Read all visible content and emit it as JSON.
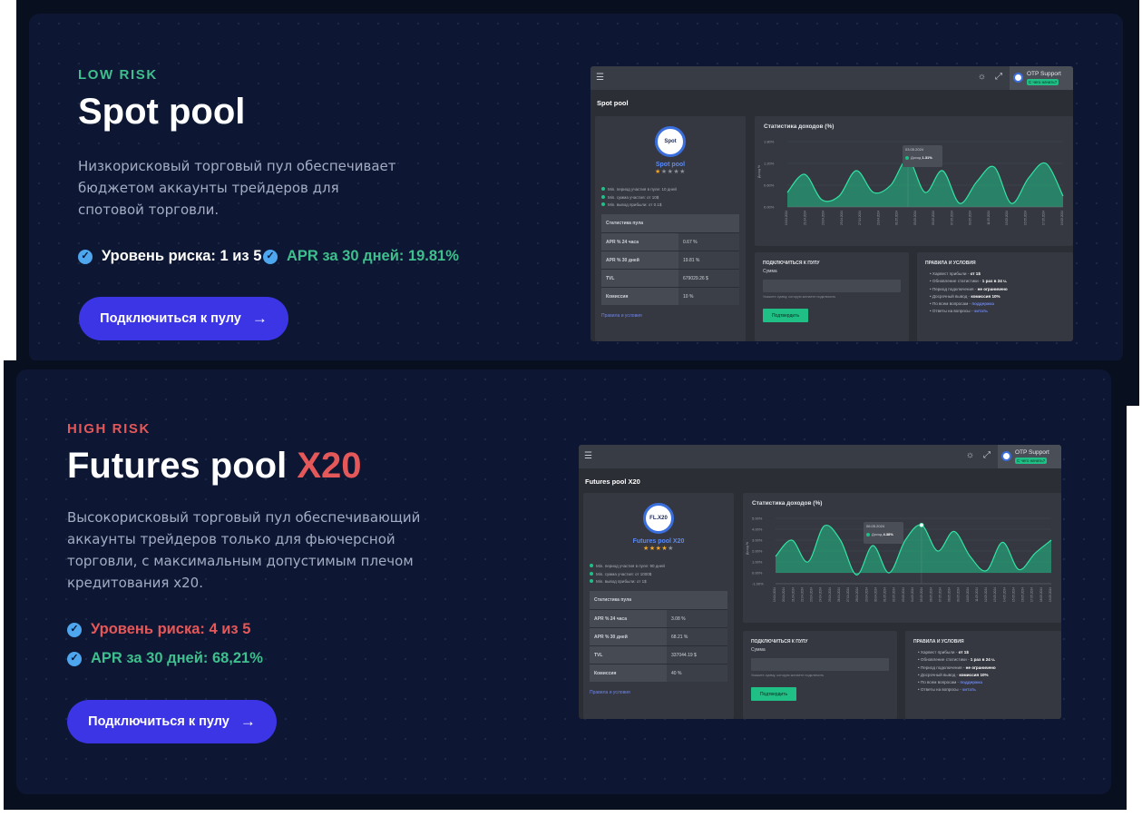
{
  "spot": {
    "risk_tag": "LOW RISK",
    "title": "Spot pool",
    "description": "Низкорисковый торговый пул обеспечивает бюджетом аккаунты трейдеров для спотовой торговли.",
    "feature_risk": "Уровень риска: 1 из 5",
    "feature_apr": "APR за 30 дней: 19.81%",
    "cta": "Подключиться к пулу",
    "preview": {
      "menu_icon": "hamburger-icon",
      "theme_icon": "sun-icon",
      "fullscreen_icon": "expand-icon",
      "user_name": "OTP Support",
      "user_badge": "С чего начать?",
      "page_title": "Spot pool",
      "logo_text": "Spot",
      "pool_name": "Spot pool",
      "rating": 1,
      "rating_max": 5,
      "bullets": [
        "Min. период участия в пуле: 10 дней",
        "Min. сумма участия: от 10$",
        "Min. вывод прибыли: от 0.1$"
      ],
      "stats_title": "Статистика пула",
      "stats": [
        {
          "label": "APR % 24 часа",
          "value": "0.67 %"
        },
        {
          "label": "APR % 30 дней",
          "value": "19.81 %"
        },
        {
          "label": "TVL",
          "value": "679029.26 $"
        },
        {
          "label": "Комиссия",
          "value": "10 %"
        }
      ],
      "rules_link": "Правила и условия",
      "chart_title": "Статистика доходов (%)",
      "tooltip_date": "03.05.2024",
      "tooltip_label": "Доход",
      "tooltip_value": "1.31%",
      "connect_title": "Подключиться к пулу",
      "amount_label": "Сумма",
      "amount_hint": "Укажите сумму, которую желаете подключить",
      "confirm_button": "Подтвердить",
      "rules_title": "Правила и условия",
      "rules": [
        {
          "text": "Харвест прибыли - ",
          "value": "от 1$"
        },
        {
          "text": "Обновление статистики - ",
          "value": "1 раз в 24 ч."
        },
        {
          "text": "Период подключения - ",
          "value": "не ограничено"
        },
        {
          "text": "Досрочный вывод - ",
          "value": "комиссия 10%"
        },
        {
          "text": "По всем вопросам - ",
          "value": "поддержка",
          "link": true
        },
        {
          "text": "Ответы на вопросы - ",
          "value": "читать",
          "link": true
        }
      ]
    }
  },
  "futures": {
    "risk_tag": "HIGH RISK",
    "title": "Futures pool ",
    "title_accent": "X20",
    "description": "Высокорисковый торговый пул обеспечивающий аккаунты трейдеров только для фьючерсной торговли, с максимальным допустимым плечом кредитования x20.",
    "feature_risk": "Уровень риска: 4 из 5",
    "feature_apr": "APR за 30 дней: 68,21%",
    "cta": "Подключиться к пулу",
    "preview": {
      "menu_icon": "hamburger-icon",
      "theme_icon": "sun-icon",
      "fullscreen_icon": "expand-icon",
      "user_name": "OTP Support",
      "user_badge": "С чего начать?",
      "page_title": "Futures pool X20",
      "logo_text": "FL.X20",
      "pool_name": "Futures pool X20",
      "rating": 4,
      "rating_max": 5,
      "bullets": [
        "Min. период участия в пуле: 90 дней",
        "Min. сумма участия: от 1000$",
        "Min. вывод прибыли: от 1$"
      ],
      "stats_title": "Статистика пула",
      "stats": [
        {
          "label": "APR % 24 часа",
          "value": "3.08 %"
        },
        {
          "label": "APR % 30 дней",
          "value": "68.21 %"
        },
        {
          "label": "TVL",
          "value": "337044.19 $"
        },
        {
          "label": "Комиссия",
          "value": "40 %"
        }
      ],
      "rules_link": "Правила и условия",
      "chart_title": "Статистика доходов (%)",
      "tooltip_date": "06.05.2024",
      "tooltip_label": "Доход",
      "tooltip_value": "4.38%",
      "connect_title": "Подключиться к пулу",
      "amount_label": "Сумма",
      "amount_hint": "Укажите сумму, которую желаете подключить",
      "confirm_button": "Подтвердить",
      "rules_title": "Правила и условия",
      "rules": [
        {
          "text": "Харвест прибыли - ",
          "value": "от 1$"
        },
        {
          "text": "Обновление статистики - ",
          "value": "1 раз в 24 ч."
        },
        {
          "text": "Период подключения - ",
          "value": "не ограничено"
        },
        {
          "text": "Досрочный вывод - ",
          "value": "комиссия 10%"
        },
        {
          "text": "По всем вопросам - ",
          "value": "поддержка",
          "link": true
        },
        {
          "text": "Ответы на вопросы - ",
          "value": "читать",
          "link": true
        }
      ]
    }
  },
  "colors": {
    "page_bg": "#08101f",
    "card_bg": "#0d1733",
    "low_risk": "#3fbf8d",
    "high_risk": "#e4585a",
    "check": "#4da6ee",
    "cta": "#3c35e6",
    "chart_fill": "#1fbf86"
  },
  "chart_data": [
    {
      "type": "area",
      "title": "Статистика доходов (%)",
      "ylabel": "Доход %",
      "ylim": [
        0,
        1.8
      ],
      "yticks": [
        "0.00%",
        "0.60%",
        "1.20%",
        "1.80%"
      ],
      "x": [
        "19.04.2024",
        "21.04.2024",
        "23.04.2024",
        "25.04.2024",
        "27.04.2024",
        "29.04.2024",
        "01.05.2024",
        "03.05.2024",
        "05.05.2024",
        "07.05.2024",
        "09.05.2024",
        "11.05.2024",
        "13.05.2024",
        "15.05.2024",
        "17.05.2024",
        "19.05.2024"
      ],
      "y": [
        0.4,
        0.9,
        0.2,
        0.3,
        1.0,
        0.4,
        0.6,
        1.31,
        0.4,
        1.0,
        0.1,
        0.7,
        1.1,
        0.1,
        0.8,
        1.2,
        0.3
      ]
    },
    {
      "type": "area",
      "title": "Статистика доходов (%)",
      "ylabel": "Доход %",
      "ylim": [
        -1,
        5
      ],
      "yticks": [
        "-1.00%",
        "0.00%",
        "1.00%",
        "2.00%",
        "3.00%",
        "4.00%",
        "5.00%"
      ],
      "x": [
        "19.04.2024",
        "20.04.2024",
        "21.04.2024",
        "22.04.2024",
        "23.04.2024",
        "24.04.2024",
        "25.04.2024",
        "26.04.2024",
        "27.04.2024",
        "28.04.2024",
        "29.04.2024",
        "30.04.2024",
        "01.05.2024",
        "02.05.2024",
        "03.05.2024",
        "04.05.2024",
        "05.05.2024",
        "06.05.2024",
        "07.05.2024",
        "08.05.2024",
        "09.05.2024",
        "10.05.2024",
        "11.05.2024",
        "12.05.2024",
        "13.05.2024",
        "14.05.2024",
        "15.05.2024",
        "16.05.2024",
        "17.05.2024",
        "18.05.2024",
        "19.05.2024"
      ],
      "y": [
        1.5,
        3.0,
        1.0,
        4.3,
        3.0,
        -0.2,
        2.5,
        0.0,
        3.0,
        4.38,
        2.0,
        3.8,
        1.5,
        0.2,
        2.8,
        0.3,
        1.8,
        3.0
      ]
    }
  ]
}
